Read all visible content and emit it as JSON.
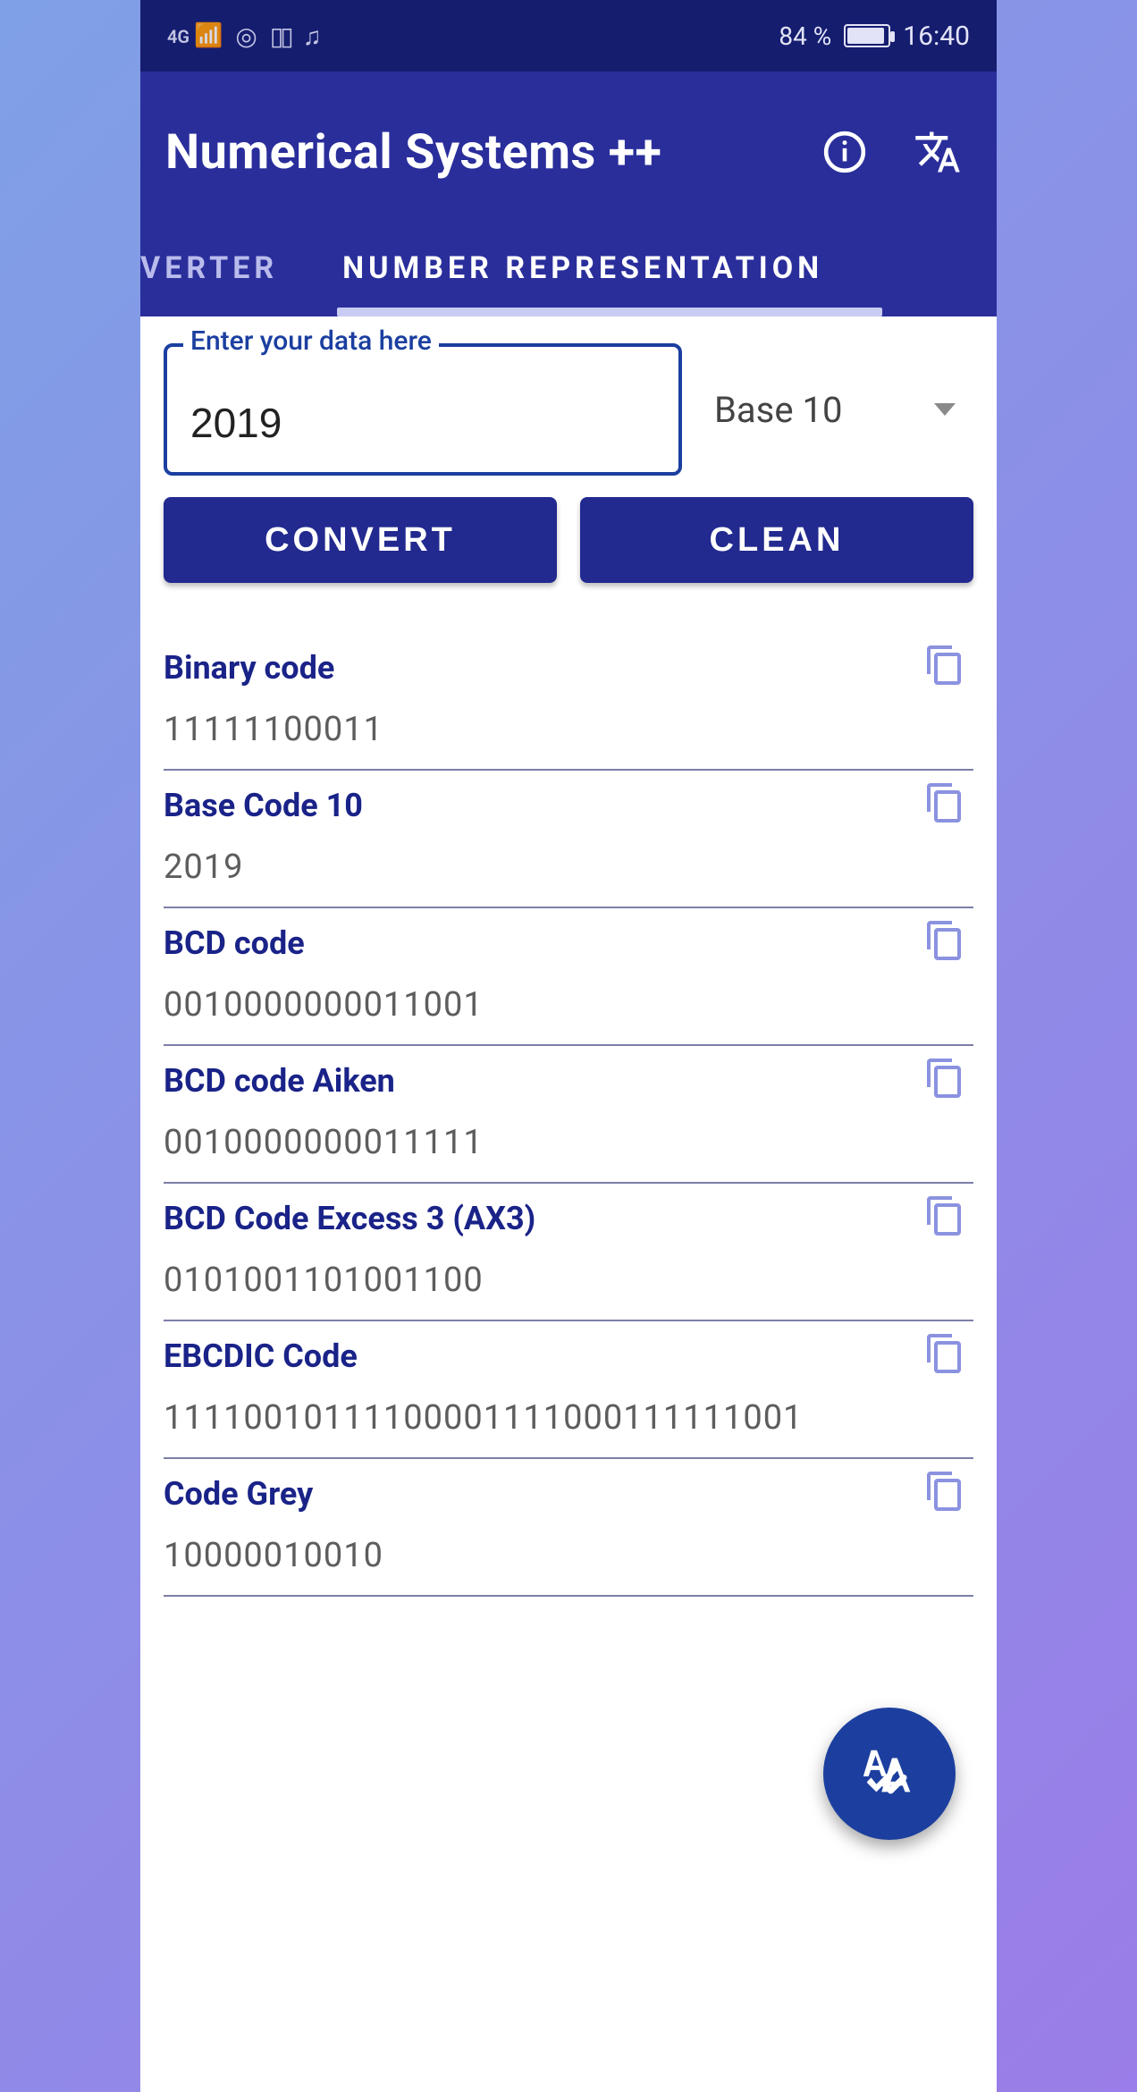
{
  "statusbar": {
    "network": "4G",
    "battery_text": "84 %",
    "time": "16:40"
  },
  "appbar": {
    "title": "Numerical Systems ++"
  },
  "tabs": {
    "inactive_left": "VERTER",
    "active": "NUMBER REPRESENTATION"
  },
  "input": {
    "label": "Enter your data here",
    "value": "2019"
  },
  "base_select": {
    "selected": "Base 10"
  },
  "buttons": {
    "convert": "CONVERT",
    "clean": "CLEAN"
  },
  "results": [
    {
      "label": "Binary code",
      "value": "11111100011"
    },
    {
      "label": "Base Code 10",
      "value": "2019"
    },
    {
      "label": "BCD code",
      "value": "0010000000011001"
    },
    {
      "label": "BCD code Aiken",
      "value": "0010000000011111"
    },
    {
      "label": "BCD Code Excess 3 (AX3)",
      "value": "0101001101001100"
    },
    {
      "label": "EBCDIC Code",
      "value": "11110010111100001111000111111001"
    },
    {
      "label": "Code Grey",
      "value": "10000010010"
    }
  ]
}
